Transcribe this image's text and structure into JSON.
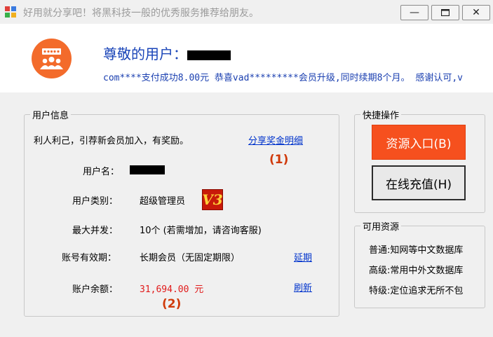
{
  "window": {
    "title": "好用就分享吧！将黑科技一般的优秀服务推荐给朋友。",
    "minimize_glyph": "—",
    "maximize_glyph": "▫",
    "close_glyph": "✕"
  },
  "header": {
    "greeting": "尊敬的用户：",
    "marquee_text": "com****支付成功8.00元 恭喜vad*********会员升级,同时续期8个月。 感谢认可,v"
  },
  "user_info": {
    "legend": "用户信息",
    "intro": "利人利己，引荐新会员加入，有奖励。",
    "share_link": "分享奖金明细",
    "annotation_1": "(1)",
    "username_label": "用户名：",
    "user_type_label": "用户类别：",
    "user_type_value": "超级管理员",
    "vip_badge": "V3",
    "max_concurrent_label": "最大并发：",
    "max_concurrent_value": "10个 (若需增加，请咨询客服)",
    "validity_label": "账号有效期：",
    "validity_value": "长期会员（无固定期限）",
    "extend_link": "延期",
    "balance_label": "账户余额：",
    "balance_value": "31,694.00 元",
    "refresh_link": "刷新",
    "annotation_2": "(2)"
  },
  "quick_actions": {
    "legend": "快捷操作",
    "resource_button": "资源入口(B)",
    "recharge_button": "在线充值(H)"
  },
  "available_resources": {
    "legend": "可用资源",
    "items": [
      "普通:知网等中文数据库",
      "高级:常用中外文数据库",
      "特级:定位追求无所不包"
    ]
  },
  "colors": {
    "accent_orange": "#f6501e",
    "link_blue": "#0033cc",
    "balance_red": "#e11a1a",
    "title_blue": "#1a45b8"
  }
}
